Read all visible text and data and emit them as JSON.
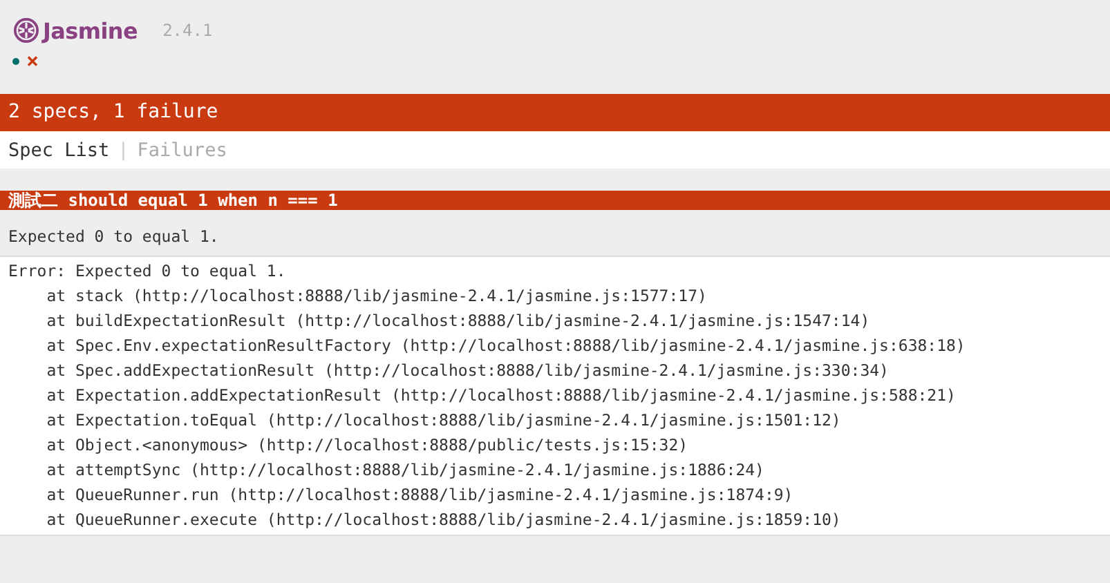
{
  "header": {
    "logo": "Jasmine",
    "version": "2.4.1"
  },
  "results": [
    {
      "kind": "passed"
    },
    {
      "kind": "failed",
      "symbol": "×"
    }
  ],
  "summary": {
    "text": "2 specs, 1 failure",
    "kind": "failed"
  },
  "tabs": [
    {
      "label": "Spec List",
      "selected": true
    },
    {
      "label": "Failures",
      "selected": false
    }
  ],
  "tab_separator": "|",
  "failures": [
    {
      "title": "測試二 should equal 1 when n === 1",
      "message": "Expected 0 to equal 1.",
      "stack": [
        "Error: Expected 0 to equal 1.",
        "    at stack (http://localhost:8888/lib/jasmine-2.4.1/jasmine.js:1577:17)",
        "    at buildExpectationResult (http://localhost:8888/lib/jasmine-2.4.1/jasmine.js:1547:14)",
        "    at Spec.Env.expectationResultFactory (http://localhost:8888/lib/jasmine-2.4.1/jasmine.js:638:18)",
        "    at Spec.addExpectationResult (http://localhost:8888/lib/jasmine-2.4.1/jasmine.js:330:34)",
        "    at Expectation.addExpectationResult (http://localhost:8888/lib/jasmine-2.4.1/jasmine.js:588:21)",
        "    at Expectation.toEqual (http://localhost:8888/lib/jasmine-2.4.1/jasmine.js:1501:12)",
        "    at Object.<anonymous> (http://localhost:8888/public/tests.js:15:32)",
        "    at attemptSync (http://localhost:8888/lib/jasmine-2.4.1/jasmine.js:1886:24)",
        "    at QueueRunner.run (http://localhost:8888/lib/jasmine-2.4.1/jasmine.js:1874:9)",
        "    at QueueRunner.execute (http://localhost:8888/lib/jasmine-2.4.1/jasmine.js:1859:10)"
      ]
    }
  ]
}
